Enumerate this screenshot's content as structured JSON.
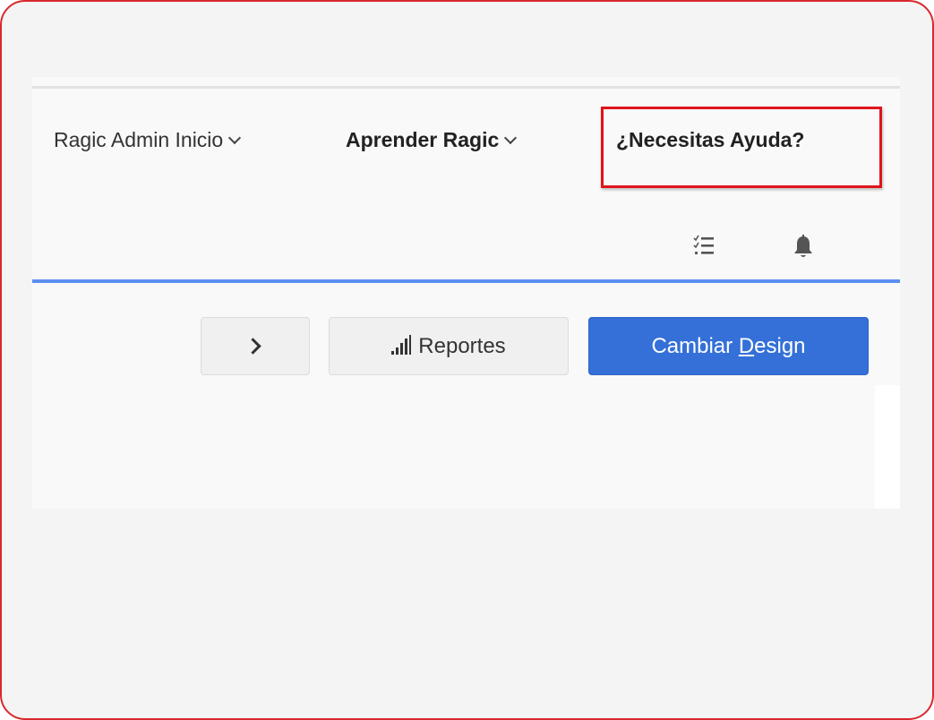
{
  "nav": {
    "admin_home": "Ragic Admin Inicio",
    "learn": "Aprender Ragic",
    "help": "¿Necesitas Ayuda?"
  },
  "icons": {
    "tasks": "task-list-icon",
    "notifications": "bell-icon",
    "expand": "chevron-right-icon",
    "reports": "bar-chart-icon"
  },
  "toolbar": {
    "reports_label": "Reportes",
    "design_label_prefix": "Cambiar ",
    "design_label_accel": "D",
    "design_label_suffix": "esign"
  },
  "colors": {
    "highlight_border": "#e0141b",
    "frame_border": "#d9292e",
    "accent_line": "#5d8ff0",
    "primary_button": "#3470d8"
  }
}
